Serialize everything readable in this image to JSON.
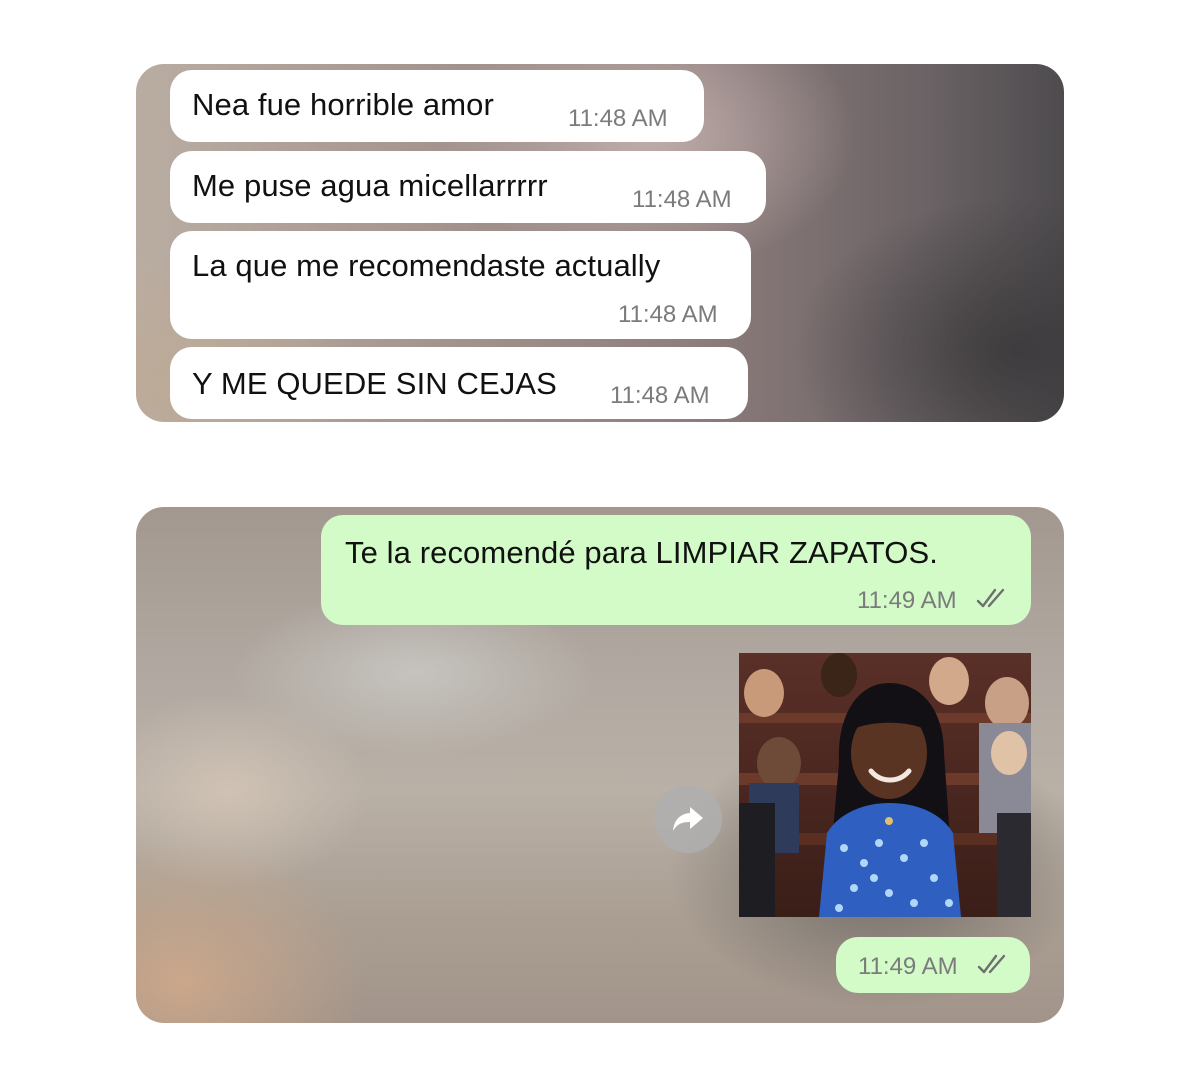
{
  "conversation_top": {
    "messages": [
      {
        "text": "Nea fue horrible amor",
        "time": "11:48 AM"
      },
      {
        "text": "Me puse agua micellarrrrr",
        "time": "11:48 AM"
      },
      {
        "text": "La que me recomendaste actually",
        "time": "11:48 AM"
      },
      {
        "text": "Y ME QUEDE SIN CEJAS",
        "time": "11:48 AM"
      }
    ]
  },
  "conversation_bottom": {
    "reply": {
      "text": "Te la recomendé para LIMPIAR ZAPATOS.",
      "time": "11:49 AM",
      "status": "read"
    },
    "gif_message": {
      "time": "11:49 AM",
      "status": "read",
      "media": "gif-woman-in-blue-blouse-smiling"
    },
    "forward_icon": "forward-arrow-icon"
  },
  "colors": {
    "incoming_bubble": "#ffffff",
    "outgoing_bubble": "#d2fbc8",
    "timestamp": "#7b7b7b",
    "text": "#111111"
  }
}
